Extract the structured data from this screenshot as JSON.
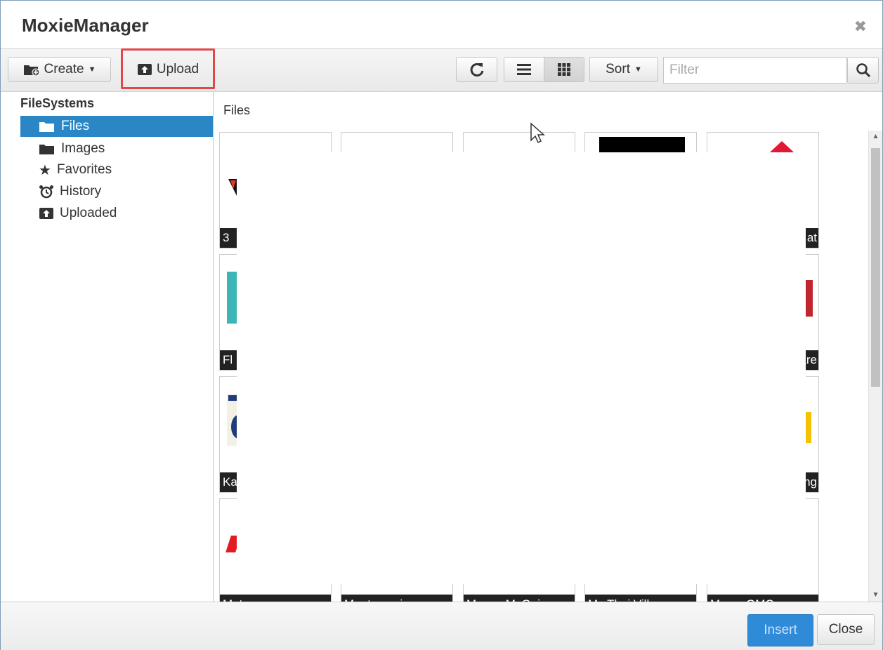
{
  "window": {
    "title": "MoxieManager"
  },
  "toolbar": {
    "create_label": "Create",
    "upload_label": "Upload",
    "sort_label": "Sort",
    "filter_placeholder": "Filter"
  },
  "sidebar": {
    "heading": "FileSystems",
    "items": [
      {
        "label": "Files",
        "icon": "folder-open-icon",
        "active": true
      },
      {
        "label": "Images",
        "icon": "folder-icon"
      },
      {
        "label": "Favorites",
        "icon": "star-icon"
      },
      {
        "label": "History",
        "icon": "alarm-clock-icon"
      },
      {
        "label": "Uploaded",
        "icon": "upload-box-icon"
      }
    ]
  },
  "main": {
    "breadcrumb": "Files",
    "thumbnails": [
      {
        "label": "3"
      },
      {
        "label": ""
      },
      {
        "label": ""
      },
      {
        "label": ""
      },
      {
        "label": "at"
      },
      {
        "label": "Fl"
      },
      {
        "label": "are"
      },
      {
        "label": "Ka"
      },
      {
        "label": "ng"
      },
      {
        "label": "Metro.png"
      },
      {
        "label": "Montanas.jpg"
      },
      {
        "label": "Moose McGuire"
      },
      {
        "label": "My Thai Village"
      },
      {
        "label": "Myers GMC.png"
      }
    ]
  },
  "footer": {
    "insert_label": "Insert",
    "close_label": "Close"
  },
  "colors": {
    "accent": "#2a86c4",
    "highlight": "#e0464a"
  }
}
